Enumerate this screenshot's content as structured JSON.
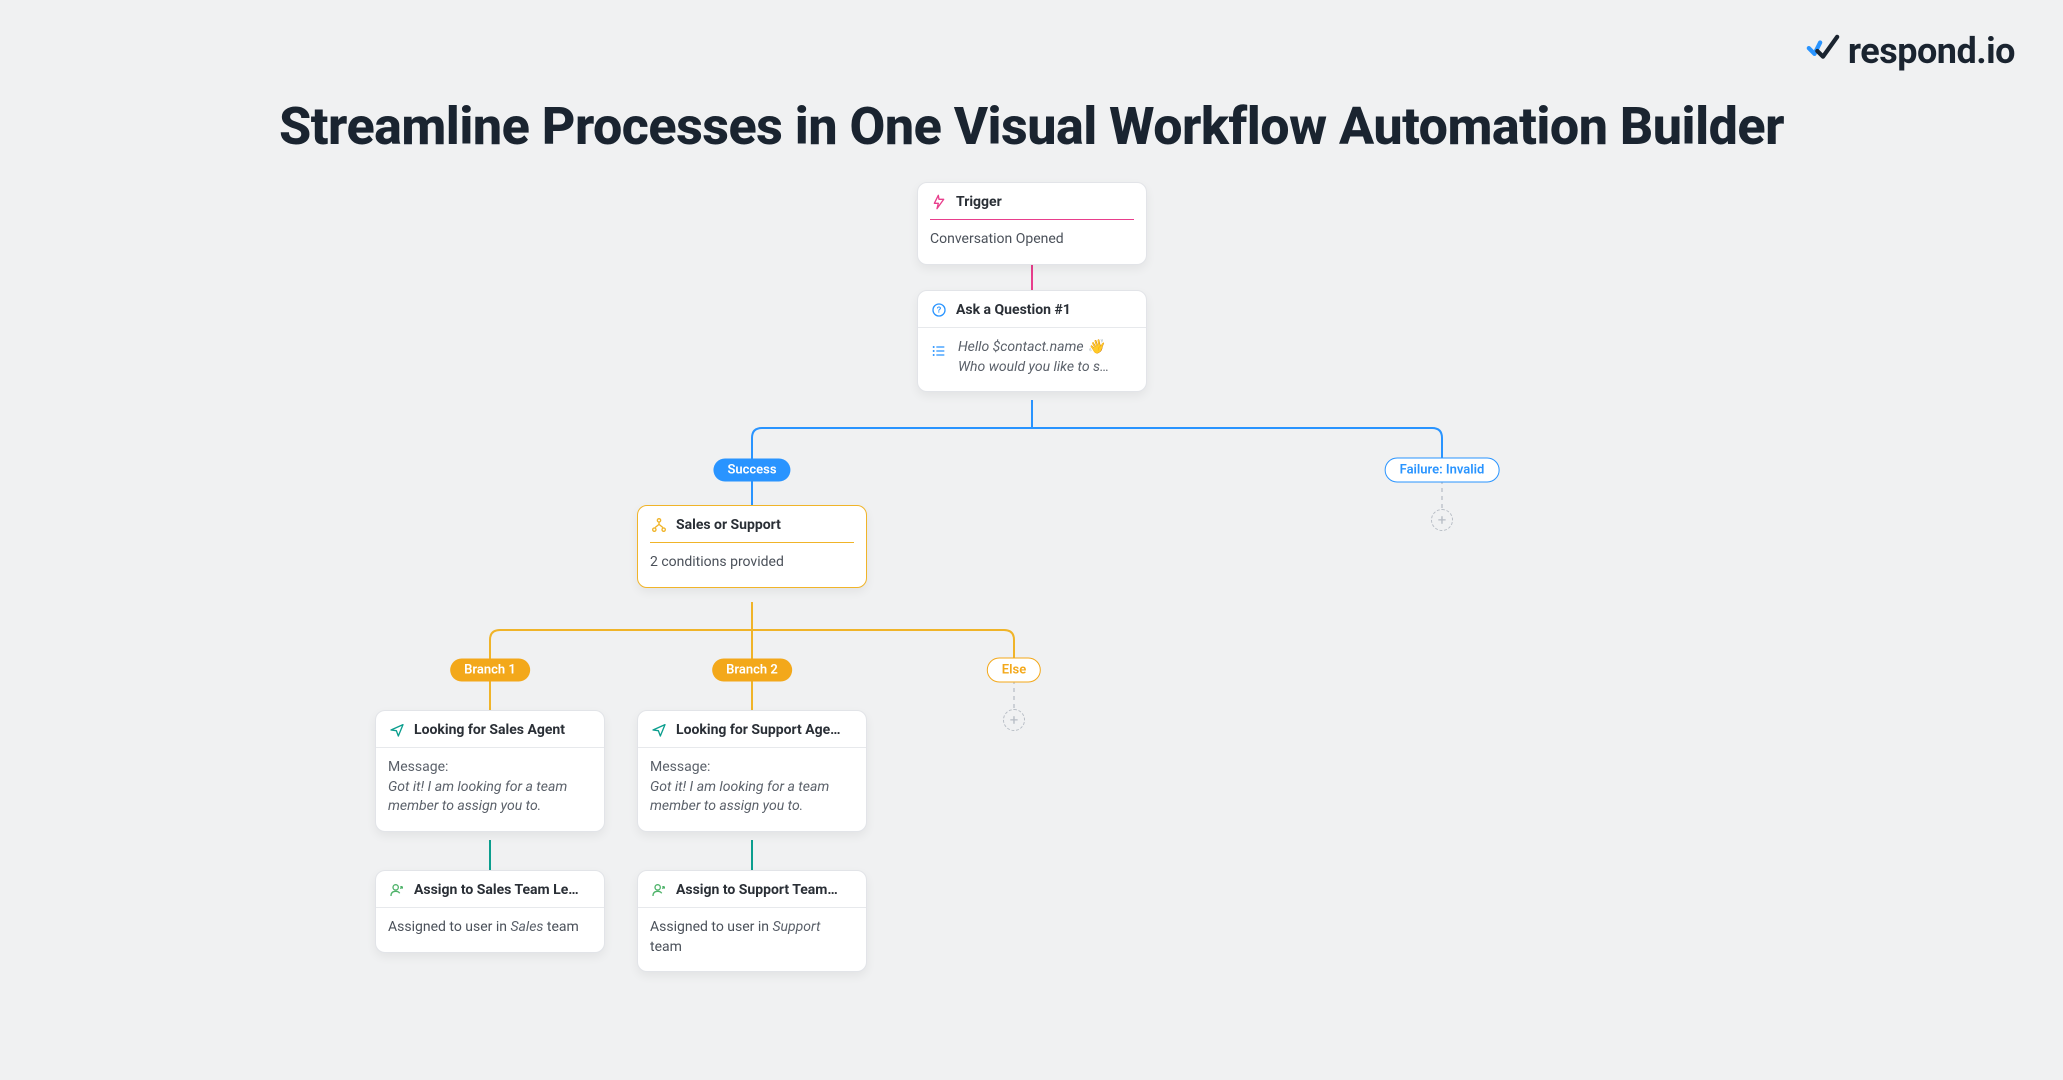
{
  "brand": {
    "name": "respond.io"
  },
  "headline": "Streamline Processes in One Visual Workflow Automation Builder",
  "colors": {
    "pink": "#e83e8c",
    "blue": "#2994ff",
    "amber": "#f0b429",
    "teal": "#0b9e8e",
    "green": "#4fb36a"
  },
  "nodes": {
    "trigger": {
      "title": "Trigger",
      "body": "Conversation Opened"
    },
    "question": {
      "title": "Ask a Question #1",
      "line1": "Hello $contact.name 👋",
      "line2": "Who would you like to s…"
    },
    "branches": {
      "success_label": "Success",
      "failure_label": "Failure: Invalid"
    },
    "condition": {
      "title": "Sales or Support",
      "body": "2 conditions provided"
    },
    "cond_branches": {
      "b1": "Branch 1",
      "b2": "Branch 2",
      "else": "Else"
    },
    "sales_msg": {
      "title": "Looking for Sales Agent",
      "label": "Message:",
      "body": "Got it! I am looking for a team member to assign you to."
    },
    "support_msg": {
      "title": "Looking for Support Age…",
      "label": "Message:",
      "body": "Got it! I am looking for a team member to assign you to."
    },
    "sales_assign": {
      "title": "Assign to Sales Team Le…",
      "prefix": "Assigned to user in ",
      "team": "Sales",
      "suffix": " team"
    },
    "support_assign": {
      "title": "Assign to Support Team…",
      "prefix": "Assigned to user in ",
      "team": "Support",
      "suffix": " team"
    }
  }
}
